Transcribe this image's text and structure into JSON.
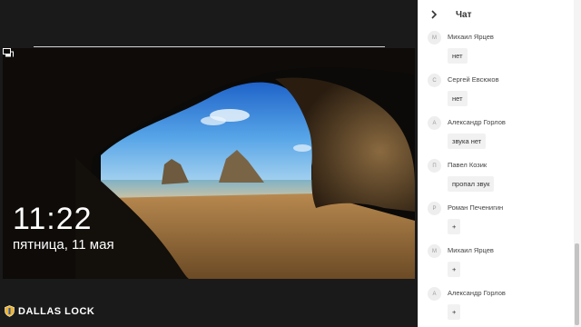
{
  "lockscreen": {
    "time": "11:22",
    "date": "пятница, 11 мая"
  },
  "brand": {
    "label": "DALLAS LOCK"
  },
  "chat": {
    "title": "Чат",
    "messages": [
      {
        "initial": "М",
        "author": "Михаил Ярцев",
        "text": "нет"
      },
      {
        "initial": "С",
        "author": "Сергей Евсюков",
        "text": "нет"
      },
      {
        "initial": "А",
        "author": "Александр Горлов",
        "text": "звука нет"
      },
      {
        "initial": "П",
        "author": "Павел Козик",
        "text": "пропал звук"
      },
      {
        "initial": "Р",
        "author": "Роман Печенигин",
        "text": "+"
      },
      {
        "initial": "М",
        "author": "Михаил Ярцев",
        "text": "+"
      },
      {
        "initial": "А",
        "author": "Александр Горлов",
        "text": "+"
      }
    ]
  },
  "icons": {
    "chat_collapse": "chevron-right-icon",
    "network": "network-icon",
    "brand": "shield-icon"
  },
  "colors": {
    "chat_bg": "#ffffff",
    "bubble_bg": "#f1f1f1",
    "screen_bg": "#0c0c0c"
  }
}
